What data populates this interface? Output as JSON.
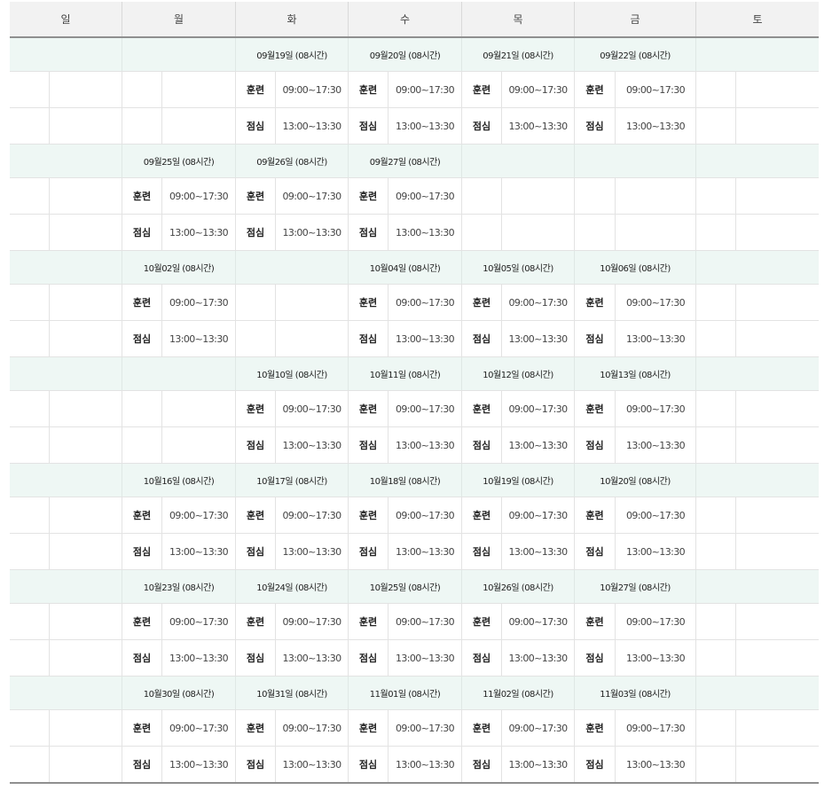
{
  "weekdays": [
    "일",
    "월",
    "화",
    "수",
    "목",
    "금",
    "토"
  ],
  "labels": {
    "train": "훈련",
    "lunch": "점심"
  },
  "times": {
    "train": "09:00~17:30",
    "lunch": "13:00~13:30"
  },
  "weeks": [
    {
      "days": [
        null,
        null,
        "09월19일 (08시간)",
        "09월20일 (08시간)",
        "09월21일 (08시간)",
        "09월22일 (08시간)",
        null
      ]
    },
    {
      "days": [
        null,
        "09월25일 (08시간)",
        "09월26일 (08시간)",
        "09월27일 (08시간)",
        null,
        null,
        null
      ]
    },
    {
      "days": [
        null,
        "10월02일 (08시간)",
        null,
        "10월04일 (08시간)",
        "10월05일 (08시간)",
        "10월06일 (08시간)",
        null
      ]
    },
    {
      "days": [
        null,
        null,
        "10월10일 (08시간)",
        "10월11일 (08시간)",
        "10월12일 (08시간)",
        "10월13일 (08시간)",
        null
      ]
    },
    {
      "days": [
        null,
        "10월16일 (08시간)",
        "10월17일 (08시간)",
        "10월18일 (08시간)",
        "10월19일 (08시간)",
        "10월20일 (08시간)",
        null
      ]
    },
    {
      "days": [
        null,
        "10월23일 (08시간)",
        "10월24일 (08시간)",
        "10월25일 (08시간)",
        "10월26일 (08시간)",
        "10월27일 (08시간)",
        null
      ]
    },
    {
      "days": [
        null,
        "10월30일 (08시간)",
        "10월31일 (08시간)",
        "11월01일 (08시간)",
        "11월02일 (08시간)",
        "11월03일 (08시간)",
        null
      ]
    }
  ]
}
